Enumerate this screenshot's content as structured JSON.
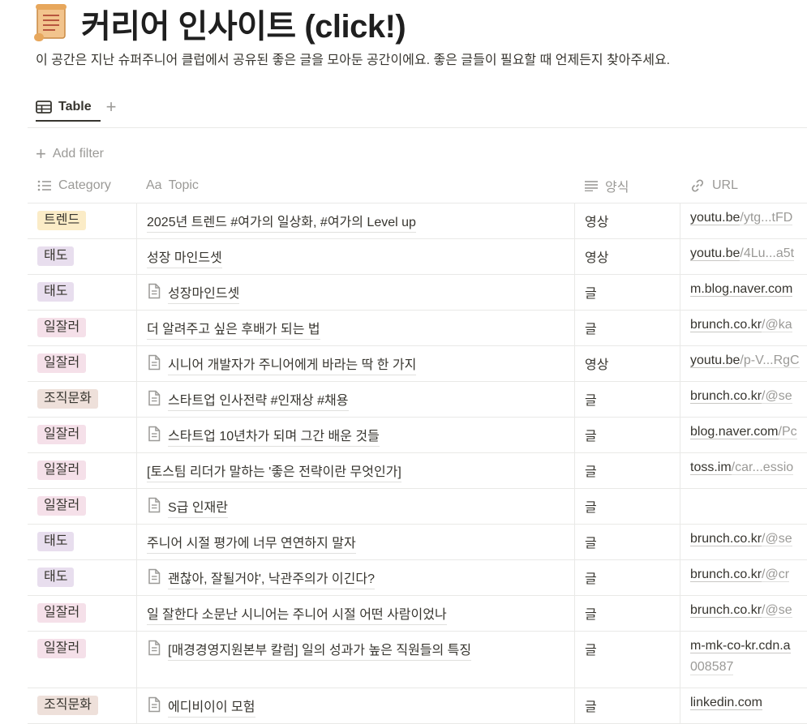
{
  "page": {
    "icon": "scroll-icon",
    "title": "커리어 인사이트 (click!)",
    "description": "이 공간은 지난 슈퍼주니어 클럽에서 공유된 좋은 글을 모아둔 공간이에요. 좋은 글들이 필요할 때 언제든지 찾아주세요."
  },
  "view": {
    "active_tab": "Table",
    "tab_icon": "table-icon",
    "add_view_icon": "plus-icon",
    "add_filter": "Add filter"
  },
  "columns": [
    {
      "label": "Category",
      "icon": "list-icon"
    },
    {
      "label": "Topic",
      "icon": "text-aa-icon",
      "prefix": "Aa"
    },
    {
      "label": "양식",
      "icon": "text-lines-icon"
    },
    {
      "label": "URL",
      "icon": "link-icon"
    }
  ],
  "colors": {
    "트렌드": "#fbecc7",
    "태도": "#e8deee",
    "일잘러": "#f5e0e9",
    "조직문화": "#eee0da"
  },
  "rows": [
    {
      "category": "트렌드",
      "topic": "2025년 트렌드 #여가의 일상화, #여가의 Level up",
      "doc": false,
      "format": "영상",
      "url_main": "youtu.be",
      "url_rest": "/ytg...tFD"
    },
    {
      "category": "태도",
      "topic": "성장 마인드셋",
      "doc": false,
      "format": "영상",
      "url_main": "youtu.be",
      "url_rest": "/4Lu...a5t"
    },
    {
      "category": "태도",
      "topic": "성장마인드셋",
      "doc": true,
      "format": "글",
      "url_main": "m.blog.naver.com",
      "url_rest": ""
    },
    {
      "category": "일잘러",
      "topic": "더 알려주고 싶은 후배가 되는 법",
      "doc": false,
      "format": "글",
      "url_main": "brunch.co.kr",
      "url_rest": "/@ka"
    },
    {
      "category": "일잘러",
      "topic": " 시니어 개발자가 주니어에게 바라는 딱 한 가지",
      "doc": true,
      "format": "영상",
      "url_main": "youtu.be",
      "url_rest": "/p-V...RgC"
    },
    {
      "category": "조직문화",
      "topic": "스타트업 인사전략 #인재상 #채용",
      "doc": true,
      "format": "글",
      "url_main": "brunch.co.kr",
      "url_rest": "/@se"
    },
    {
      "category": "일잘러",
      "topic": "스타트업 10년차가 되며 그간 배운 것들",
      "doc": true,
      "format": "글",
      "url_main": "blog.naver.com",
      "url_rest": "/Pc"
    },
    {
      "category": "일잘러",
      "topic": "[토스팀 리더가 말하는 '좋은 전략이란 무엇인가]",
      "doc": false,
      "format": "글",
      "url_main": "toss.im",
      "url_rest": "/car...essio"
    },
    {
      "category": "일잘러",
      "topic": "S급 인재란",
      "doc": true,
      "format": "글",
      "url_main": "",
      "url_rest": ""
    },
    {
      "category": "태도",
      "topic": "주니어 시절 평가에 너무 연연하지 말자",
      "doc": false,
      "format": "글",
      "url_main": "brunch.co.kr",
      "url_rest": "/@se"
    },
    {
      "category": "태도",
      "topic": "괜찮아, 잘될거야', 낙관주의가 이긴다?",
      "doc": true,
      "format": "글",
      "url_main": "brunch.co.kr",
      "url_rest": "/@cr"
    },
    {
      "category": "일잘러",
      "topic": "일 잘한다 소문난 시니어는 주니어 시절 어떤 사람이었나",
      "doc": false,
      "format": "글",
      "url_main": "brunch.co.kr",
      "url_rest": "/@se"
    },
    {
      "category": "일잘러",
      "topic": "[매경경영지원본부 칼럼] 일의 성과가 높은 직원들의 특징",
      "doc": true,
      "format": "글",
      "url_main": "m-mk-co-kr.cdn.a",
      "url_rest": "",
      "url_line2": "008587"
    },
    {
      "category": "조직문화",
      "topic": "에디비이이 모험",
      "doc": true,
      "format": "글",
      "url_main": "linkedin.com",
      "url_rest": ""
    }
  ]
}
